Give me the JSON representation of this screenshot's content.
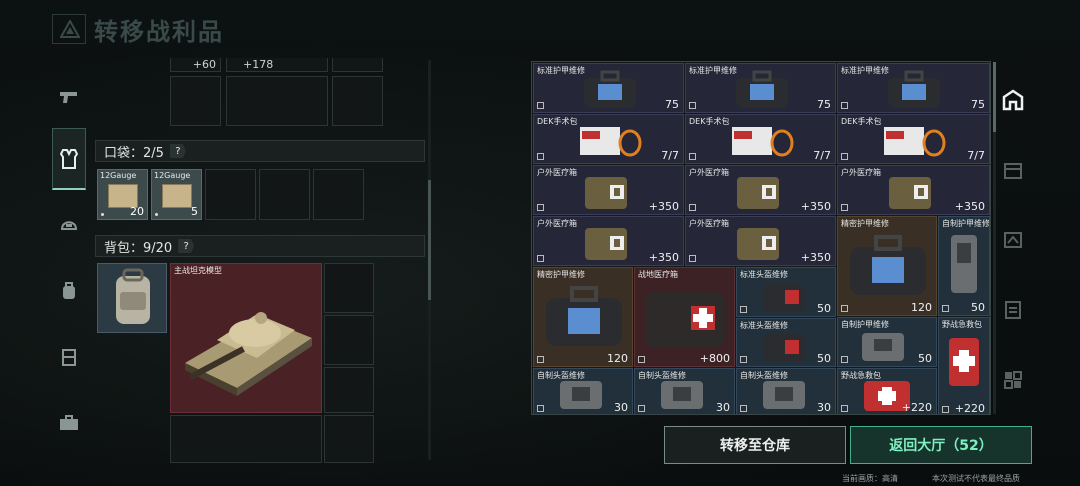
{
  "header": {
    "title": "转移战利品"
  },
  "pocket": {
    "label": "口袋：2/5",
    "help": "?",
    "items": [
      {
        "name": "12Gauge",
        "count": "20"
      },
      {
        "name": "12Gauge",
        "count": "5"
      }
    ]
  },
  "backpack": {
    "label": "背包：9/20",
    "help": "?",
    "tank_name": "主战坦克模型"
  },
  "top_values": {
    "a": "+60",
    "b": "+178"
  },
  "loot": [
    {
      "name": "标准护甲维修",
      "value": "75"
    },
    {
      "name": "标准护甲维修",
      "value": "75"
    },
    {
      "name": "标准护甲维修",
      "value": "75"
    },
    {
      "name": "DEK手术包",
      "value": "7/7"
    },
    {
      "name": "DEK手术包",
      "value": "7/7"
    },
    {
      "name": "DEK手术包",
      "value": "7/7"
    },
    {
      "name": "户外医疗箱",
      "value": "+350"
    },
    {
      "name": "户外医疗箱",
      "value": "+350"
    },
    {
      "name": "户外医疗箱",
      "value": "+350"
    },
    {
      "name": "户外医疗箱",
      "value": "+350"
    },
    {
      "name": "户外医疗箱",
      "value": "+350"
    },
    {
      "name": "精密护甲维修",
      "value": "120"
    },
    {
      "name": "自制护甲维修",
      "value": "50"
    },
    {
      "name": "精密护甲维修",
      "value": "120"
    },
    {
      "name": "战地医疗箱",
      "value": "+800"
    },
    {
      "name": "标准头盔维修",
      "value": "50"
    },
    {
      "name": "标准头盔维修",
      "value": "50"
    },
    {
      "name": "自制护甲维修",
      "value": "50"
    },
    {
      "name": "野战急救包",
      "value": "+220"
    },
    {
      "name": "自制头盔维修",
      "value": "30"
    },
    {
      "name": "自制头盔维修",
      "value": "30"
    },
    {
      "name": "自制头盔维修",
      "value": "30"
    },
    {
      "name": "野战急救包",
      "value": "+220"
    }
  ],
  "buttons": {
    "transfer": "转移至仓库",
    "return": "返回大厅（52）"
  },
  "footer": {
    "quality": "当前画质：高清",
    "note": "本次测试不代表最终品质"
  },
  "colors": {
    "accent": "#3fb088",
    "accent_text": "#7ff0c0"
  }
}
